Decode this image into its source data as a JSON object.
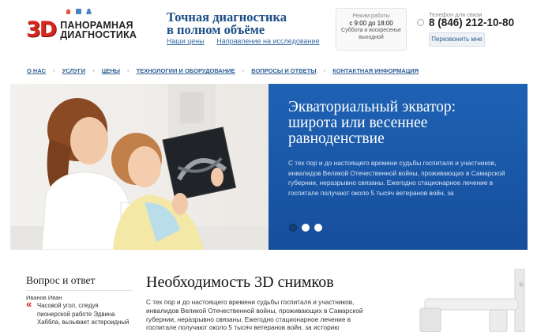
{
  "header": {
    "icons": [
      "home-icon",
      "mail-icon",
      "sitemap-icon"
    ],
    "logo_mark": "3D",
    "logo_line1": "ПАНОРАМНАЯ",
    "logo_line2": "ДИАГНОСТИКА",
    "slogan_line1": "Точная диагностика",
    "slogan_line2": "в полном объёме",
    "link_prices": "Наши цены",
    "link_referral": "Направление на исследование",
    "hours_title": "Режим работы",
    "hours_main": "с 9:00 до 18:00",
    "hours_note1": "Суббота и воскресенье",
    "hours_note2": "выходной",
    "phone_label": "Телефон для связи",
    "phone": "8 (846) 212-10-80",
    "callback_label": "Перезвонить мне"
  },
  "nav": {
    "items": [
      "О НАС",
      "УСЛУГИ",
      "ЦЕНЫ",
      "ТЕХНОЛОГИИ И ОБОРУДОВАНИЕ",
      "ВОПРОСЫ И ОТВЕТЫ",
      "КОНТАКТНАЯ ИНФОРМАЦИЯ"
    ]
  },
  "hero": {
    "title": "Экваториальный экватор: широта или весеннее равноденствие",
    "text": "С тех пор и до настоящего времени судьбы госпиталя и участников, инвалидов Великой Отечественной войны, проживающих в Самарской губернии, неразрывно связаны. Ежегодно стационарное лечение в госпитале получают около 5 тысяч ветеранов войн, за",
    "slides_total": 3,
    "active_slide": 1
  },
  "sidebar": {
    "title": "Вопрос и ответ",
    "author": "Иванов Иван",
    "quote": "Часовой угол, следуя пионерской работе Эдвина Хаббла, вызывает астероидный"
  },
  "main": {
    "title": "Необходимость 3D снимков",
    "text": "С тех пор и до настоящего времени судьбы госпиталя и участников, инвалидов Великой Отечественной войны, проживающих в Самарской губернии, неразрывно связаны. Ежегодно стационарное лечение в госпитале получают около 5 тысяч ветеранов войн, за историю существования"
  },
  "colors": {
    "brand_blue": "#1e62b4",
    "brand_red": "#d9261c",
    "link_blue": "#2d5f94"
  }
}
